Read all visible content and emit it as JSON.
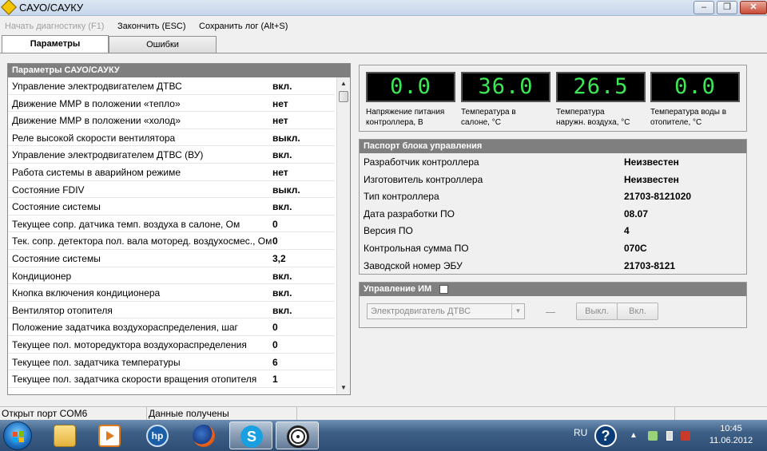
{
  "window": {
    "title": "САУО/САУКУ",
    "minimize_glyph": "–",
    "maximize_glyph": "❐",
    "close_glyph": "✕"
  },
  "menu": {
    "start_diag": "Начать диагностику (F1)",
    "finish": "Закончить (ESC)",
    "save_log": "Сохранить лог (Alt+S)"
  },
  "tabs": [
    {
      "label": "Параметры",
      "active": true
    },
    {
      "label": "Ошибки",
      "active": false
    }
  ],
  "params_panel": {
    "title": "Параметры САУО/САУКУ",
    "rows": [
      {
        "label": "Управление электродвигателем ДТВС",
        "value": "вкл."
      },
      {
        "label": "Движение ММР в положении «тепло»",
        "value": "нет"
      },
      {
        "label": "Движение ММР в положении «холод»",
        "value": "нет"
      },
      {
        "label": "Реле высокой скорости вентилятора",
        "value": "выкл."
      },
      {
        "label": "Управление электродвигателем ДТВС (ВУ)",
        "value": "вкл."
      },
      {
        "label": "Работа системы в аварийном режиме",
        "value": "нет"
      },
      {
        "label": "Состояние FDIV",
        "value": "выкл."
      },
      {
        "label": "Состояние системы",
        "value": "вкл."
      },
      {
        "label": "Текущее сопр. датчика темп. воздуха в салоне, Ом",
        "value": "0"
      },
      {
        "label": "Тек. сопр. детектора пол. вала моторед. воздухосмес., Ом",
        "value": "0"
      },
      {
        "label": "Состояние системы",
        "value": "3,2"
      },
      {
        "label": "Кондиционер",
        "value": "вкл."
      },
      {
        "label": "Кнопка включения кондиционера",
        "value": "вкл."
      },
      {
        "label": "Вентилятор отопителя",
        "value": "вкл."
      },
      {
        "label": "Положение задатчика воздухораспределения, шаг",
        "value": "0"
      },
      {
        "label": "Текущее пол. моторедуктора воздухораспределения",
        "value": "0"
      },
      {
        "label": "Текущее пол. задатчика температуры",
        "value": "6"
      },
      {
        "label": "Текущее пол. задатчика скорости вращения отопителя",
        "value": "1"
      }
    ],
    "scroll_up_glyph": "▲",
    "scroll_down_glyph": "▼"
  },
  "gauges": [
    {
      "value": "0.0",
      "caption_line1": "Напряжение питания",
      "caption_line2": "контроллера, В"
    },
    {
      "value": "36.0",
      "caption_line1": "Температура в",
      "caption_line2": "салоне, °С"
    },
    {
      "value": "26.5",
      "caption_line1": "Температура",
      "caption_line2": "наружн. воздуха, °С"
    },
    {
      "value": "0.0",
      "caption_line1": "Температура воды в",
      "caption_line2": "отопителе, °С"
    }
  ],
  "passport": {
    "title": "Паспорт блока управления",
    "rows": [
      {
        "label": "Разработчик контроллера",
        "value": "Неизвестен"
      },
      {
        "label": "Изготовитель контроллера",
        "value": "Неизвестен"
      },
      {
        "label": "Тип контроллера",
        "value": "21703-8121020"
      },
      {
        "label": "Дата разработки ПО",
        "value": "08.07"
      },
      {
        "label": "Версия ПО",
        "value": "4"
      },
      {
        "label": "Контрольная сумма ПО",
        "value": "070C"
      },
      {
        "label": "Заводской номер ЭБУ",
        "value": "21703-8121"
      }
    ]
  },
  "control": {
    "title": "Управление ИМ",
    "checked": false,
    "selected": "Электродвигатель ДТВС",
    "dropdown_glyph": "▼",
    "off_label": "Выкл.",
    "on_label": "Вкл."
  },
  "statusbar": {
    "port": "Открыт порт COM6",
    "data": "Данные получены"
  },
  "taskbar": {
    "apps": [
      {
        "icon": "folder-icon",
        "active": false
      },
      {
        "icon": "media-player-icon",
        "active": false
      },
      {
        "icon": "hp-icon",
        "active": false
      },
      {
        "icon": "firefox-icon",
        "active": false
      },
      {
        "icon": "skype-icon",
        "active": true
      },
      {
        "icon": "diagnostic-app-icon",
        "active": true
      }
    ],
    "lang": "RU",
    "help_glyph": "?",
    "tray_arrow_glyph": "▲",
    "time": "10:45",
    "date": "11.06.2012"
  }
}
